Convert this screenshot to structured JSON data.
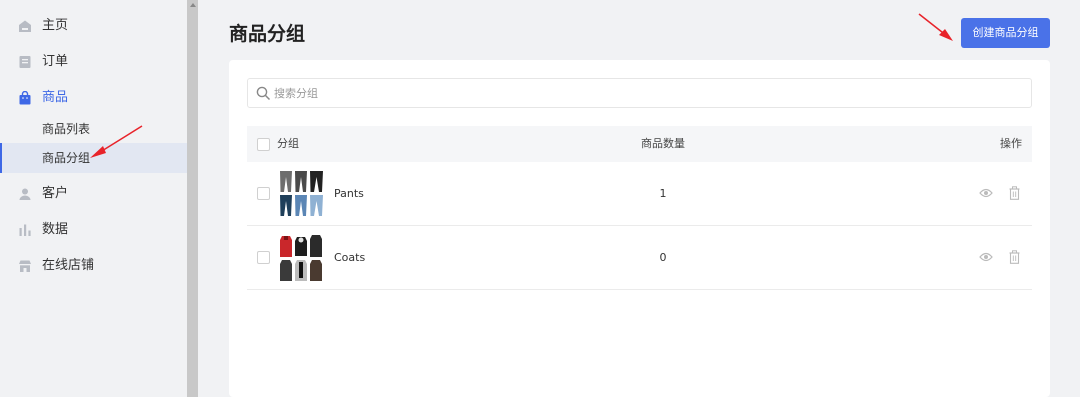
{
  "sidebar": {
    "items": [
      {
        "label": "主页",
        "icon": "home-icon"
      },
      {
        "label": "订单",
        "icon": "order-icon"
      },
      {
        "label": "商品",
        "icon": "shopping-bag-icon",
        "active": true
      },
      {
        "label": "客户",
        "icon": "user-icon"
      },
      {
        "label": "数据",
        "icon": "bar-chart-icon"
      },
      {
        "label": "在线店铺",
        "icon": "store-icon"
      }
    ],
    "sub_items": [
      {
        "label": "商品列表"
      },
      {
        "label": "商品分组",
        "selected": true
      }
    ]
  },
  "header": {
    "title": "商品分组",
    "create_button": "创建商品分组"
  },
  "search": {
    "placeholder": "搜索分组",
    "value": ""
  },
  "table": {
    "columns": [
      "分组",
      "商品数量",
      "操作"
    ],
    "rows": [
      {
        "name": "Pants",
        "count": "1",
        "thumbnail": "pants-thumbnail"
      },
      {
        "name": "Coats",
        "count": "0",
        "thumbnail": "coats-thumbnail"
      }
    ]
  },
  "colors": {
    "accent": "#4a72e8",
    "arrow": "#e8232a",
    "sidebar_bg": "#f1f2f4",
    "selected_bg": "#e2e7f2"
  }
}
